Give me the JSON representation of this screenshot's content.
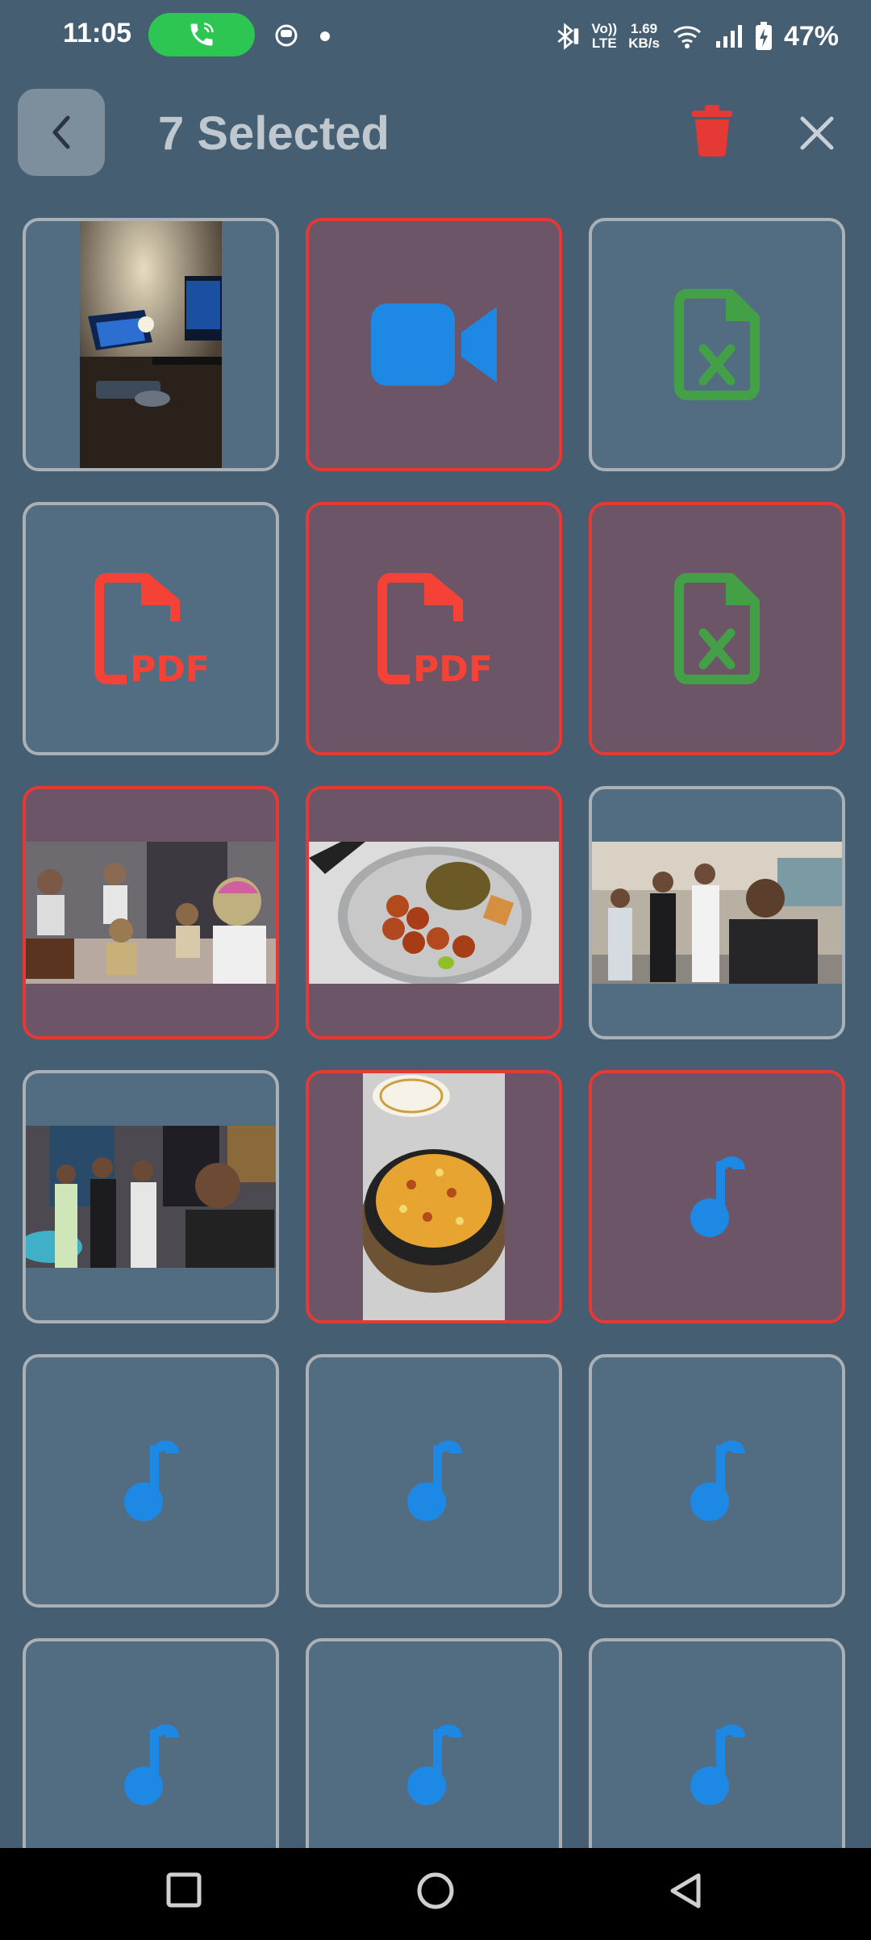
{
  "status_bar": {
    "time": "11:05",
    "network_speed_value": "1.69",
    "network_speed_unit": "KB/s",
    "volte_top": "Vo))",
    "volte_bottom": "LTE",
    "battery": "47%"
  },
  "app_bar": {
    "title": "7 Selected"
  },
  "colors": {
    "selected_border": "#e53935",
    "unselected_border": "#a9b1b7",
    "video_icon": "#1e88e5",
    "excel_icon": "#43a047",
    "pdf_icon": "#f44336",
    "music_icon": "#1e88e5",
    "delete_icon": "#e53935"
  },
  "pdf_label": "PDF",
  "grid": [
    {
      "type": "photo",
      "subject": "desk-setup",
      "selected": false
    },
    {
      "type": "video",
      "selected": true
    },
    {
      "type": "excel",
      "selected": false
    },
    {
      "type": "pdf",
      "selected": false
    },
    {
      "type": "pdf",
      "selected": true
    },
    {
      "type": "excel",
      "selected": true
    },
    {
      "type": "photo",
      "subject": "group-holi",
      "selected": true
    },
    {
      "type": "photo",
      "subject": "food-plate",
      "selected": true
    },
    {
      "type": "photo",
      "subject": "group-mall",
      "selected": false
    },
    {
      "type": "photo",
      "subject": "group-cinema",
      "selected": false
    },
    {
      "type": "photo",
      "subject": "pizza",
      "selected": true
    },
    {
      "type": "audio",
      "selected": true
    },
    {
      "type": "audio",
      "selected": false
    },
    {
      "type": "audio",
      "selected": false
    },
    {
      "type": "audio",
      "selected": false
    },
    {
      "type": "audio",
      "selected": false
    },
    {
      "type": "audio",
      "selected": false
    },
    {
      "type": "audio",
      "selected": false
    }
  ]
}
